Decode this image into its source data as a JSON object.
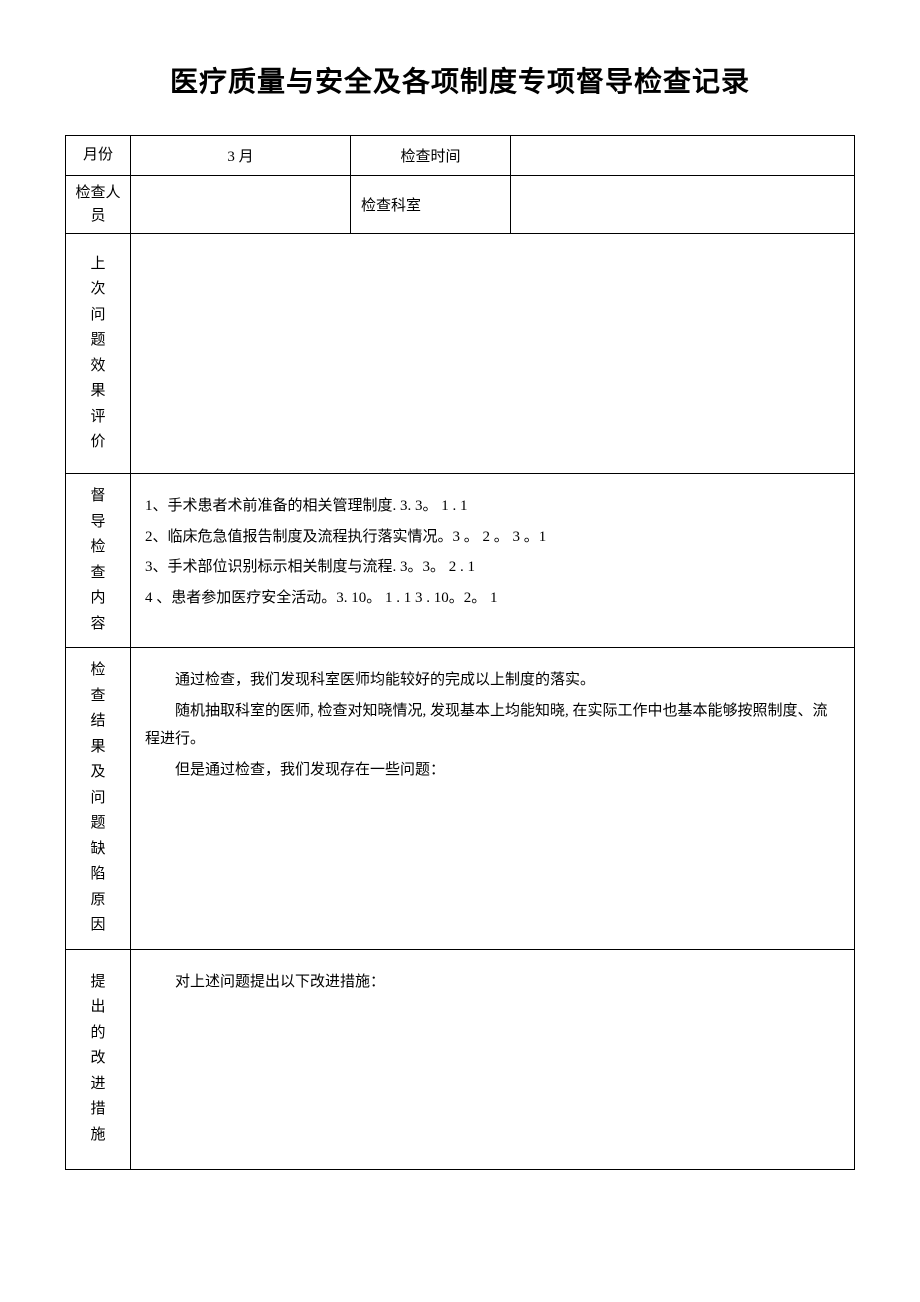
{
  "title": "医疗质量与安全及各项制度专项督导检查记录",
  "header": {
    "month_label": "月份",
    "month_value": "3 月",
    "check_time_label": "检查时间",
    "check_time_value": "",
    "inspector_label": "检查人员",
    "inspector_value": "",
    "department_label": "检查科室",
    "department_value": ""
  },
  "sections": {
    "previous_issues": {
      "label": "上次问题效果评价",
      "content": ""
    },
    "inspection_content": {
      "label": "督导检查内容",
      "lines": [
        "1、手术患者术前准备的相关管理制度. 3. 3。 1 . 1",
        "2、临床危急值报告制度及流程执行落实情况。3 。 2 。 3 。1",
        "3、手术部位识别标示相关制度与流程. 3。3。 2 . 1",
        " 4 、患者参加医疗安全活动。3. 10。 1 . 1     3 . 10。2。 1"
      ]
    },
    "results_issues": {
      "label": "检查结果及问题缺陷原因",
      "lines": [
        "通过检查，我们发现科室医师均能较好的完成以上制度的落实。",
        "随机抽取科室的医师, 检查对知晓情况, 发现基本上均能知晓, 在实际工作中也基本能够按照制度、流程进行。",
        "但是通过检查，我们发现存在一些问题："
      ]
    },
    "improvements": {
      "label": "提出的改进措施",
      "lines": [
        "对上述问题提出以下改进措施："
      ]
    }
  }
}
